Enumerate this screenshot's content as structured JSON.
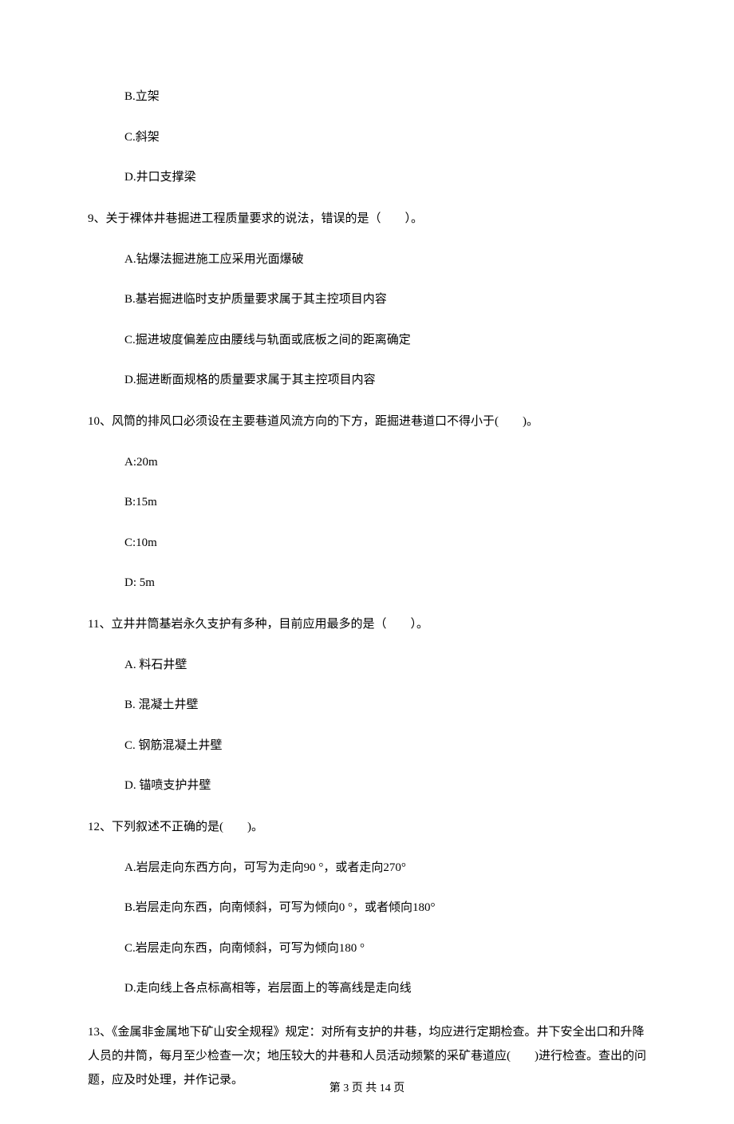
{
  "q8_options": {
    "b": "B.立架",
    "c": "C.斜架",
    "d": "D.井口支撑梁"
  },
  "q9": {
    "stem": "9、关于裸体井巷掘进工程质量要求的说法，错误的是（　　）。",
    "a": "A.钻爆法掘进施工应采用光面爆破",
    "b": "B.基岩掘进临时支护质量要求属于其主控项目内容",
    "c": "C.掘进坡度偏差应由腰线与轨面或底板之间的距离确定",
    "d": "D.掘进断面规格的质量要求属于其主控项目内容"
  },
  "q10": {
    "stem": "10、风筒的排风口必须设在主要巷道风流方向的下方，距掘进巷道口不得小于(　　)。",
    "a": "A:20m",
    "b": "B:15m",
    "c": "C:10m",
    "d": "D: 5m"
  },
  "q11": {
    "stem": "11、立井井筒基岩永久支护有多种，目前应用最多的是（　　）。",
    "a": "A. 料石井壁",
    "b": "B. 混凝土井壁",
    "c": "C. 钢筋混凝土井壁",
    "d": "D. 锚喷支护井壁"
  },
  "q12": {
    "stem": "12、下列叙述不正确的是(　　)。",
    "a": "A.岩层走向东西方向，可写为走向90 °，或者走向270°",
    "b": "B.岩层走向东西，向南倾斜，可写为倾向0 °，或者倾向180°",
    "c": "C.岩层走向东西，向南倾斜，可写为倾向180 °",
    "d": "D.走向线上各点标高相等，岩层面上的等高线是走向线"
  },
  "q13": {
    "stem": "13、《金属非金属地下矿山安全规程》规定：对所有支护的井巷，均应进行定期检查。井下安全出口和升降人员的井筒，每月至少检查一次；地压较大的井巷和人员活动频繁的采矿巷道应(　　)进行检查。查出的问题，应及时处理，并作记录。"
  },
  "footer": "第 3 页 共 14 页"
}
